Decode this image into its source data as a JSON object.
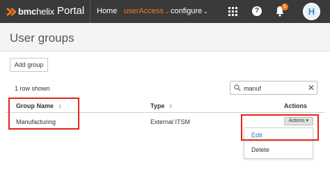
{
  "app": {
    "logo_text": "bmc",
    "logo_text_2": "helix",
    "portal_label": "Portal",
    "brand_color": "#f47b20"
  },
  "nav": {
    "items": [
      {
        "label": "Home"
      },
      {
        "label": "userAccess",
        "active": true
      },
      {
        "label": "configure"
      }
    ],
    "caret": "⌄",
    "icons": [
      "apps-grid-icon",
      "help-icon",
      "bell-icon"
    ],
    "help_glyph": "?",
    "notification_count": "1",
    "avatar_initial": "H"
  },
  "page": {
    "title": "User groups",
    "add_button": "Add group",
    "rows_shown": "1 row shown",
    "search": {
      "value": "manuf",
      "clear_glyph": "✕"
    }
  },
  "table": {
    "columns": [
      {
        "label": "Group Name",
        "sortable": true
      },
      {
        "label": "Type",
        "sortable": true
      },
      {
        "label": "Actions",
        "sortable": false
      }
    ],
    "sort_glyph": "⇕",
    "rows": [
      {
        "group_name": "Manufacturing",
        "type": "External ITSM"
      }
    ],
    "actions_button": "Actions ▾"
  },
  "actions_menu": {
    "items": [
      {
        "label": "Edit"
      },
      {
        "label": "Delete"
      }
    ]
  },
  "highlight_color": "#e2231a"
}
